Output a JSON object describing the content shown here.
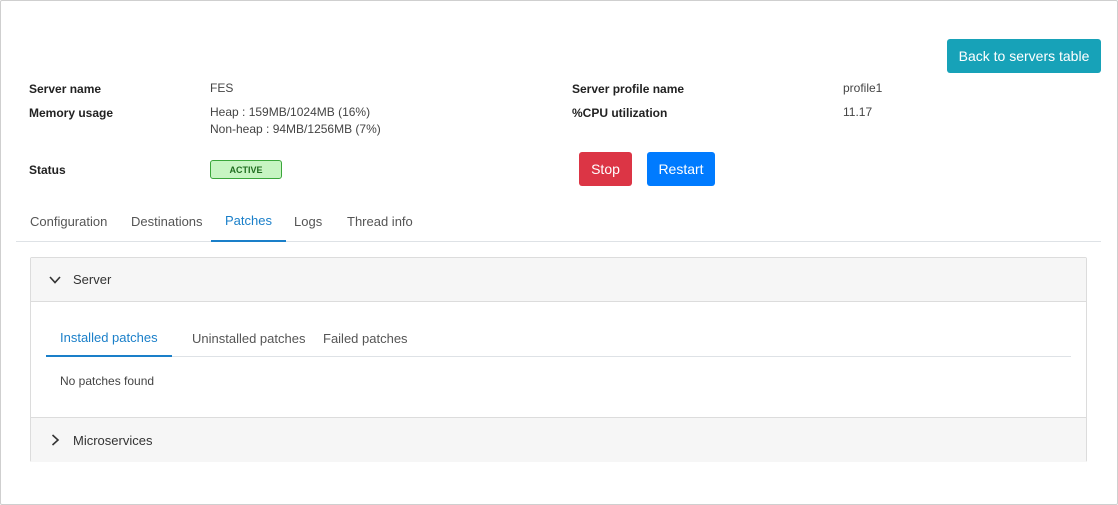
{
  "header": {
    "back_button": "Back to servers table"
  },
  "info": {
    "server_name_label": "Server name",
    "server_name_value": "FES",
    "memory_label": "Memory usage",
    "memory_heap": "Heap : 159MB/1024MB (16%)",
    "memory_nonheap": "Non-heap : 94MB/1256MB (7%)",
    "status_label": "Status",
    "status_badge": "ACTIVE",
    "profile_label": "Server profile name",
    "profile_value": "profile1",
    "cpu_label": "%CPU utilization",
    "cpu_value": "11.17"
  },
  "actions": {
    "stop": "Stop",
    "restart": "Restart"
  },
  "colors": {
    "back_button": "#17a2b8",
    "stop_button": "#dc3545",
    "restart_button": "#007bff",
    "active_tab": "#1a7fc9",
    "status_active_bg": "#c7f5c2"
  },
  "tabs": [
    {
      "label": "Configuration"
    },
    {
      "label": "Destinations"
    },
    {
      "label": "Patches"
    },
    {
      "label": "Logs"
    },
    {
      "label": "Thread info"
    }
  ],
  "active_tab": "Patches",
  "accordion": {
    "server": {
      "title": "Server",
      "expanded": true,
      "icon": "chevron-down-icon",
      "subtabs": [
        {
          "label": "Installed patches"
        },
        {
          "label": "Uninstalled patches"
        },
        {
          "label": "Failed patches"
        }
      ],
      "active_subtab": "Installed patches",
      "empty_message": "No patches found"
    },
    "microservices": {
      "title": "Microservices",
      "expanded": false,
      "icon": "chevron-right-icon"
    }
  }
}
